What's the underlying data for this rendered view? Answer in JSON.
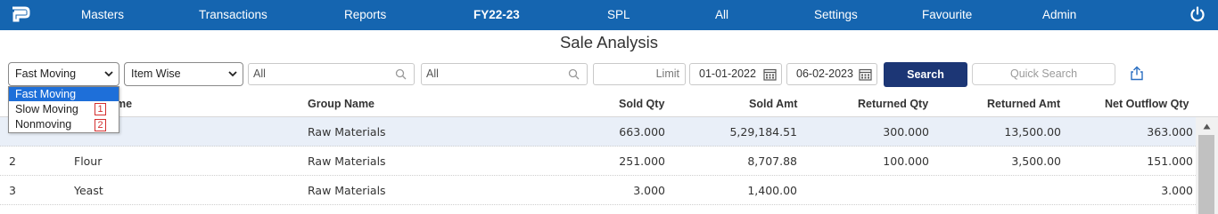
{
  "nav": {
    "items": [
      "Masters",
      "Transactions",
      "Reports",
      "FY22-23",
      "SPL",
      "All",
      "Settings",
      "Favourite",
      "Admin"
    ],
    "logo_icon": "app-logo-icon",
    "power_icon": "power-icon",
    "color": "#1565b0"
  },
  "page": {
    "title": "Sale Analysis"
  },
  "filters": {
    "movement_select": "Fast Moving",
    "grouping_select": "Item Wise",
    "search1_value": "All",
    "search2_value": "All",
    "limit_placeholder": "Limit",
    "from_date": "01-01-2022",
    "to_date": "06-02-2023",
    "search_button": "Search",
    "quick_search_placeholder": "Quick Search"
  },
  "dropdown": {
    "options": [
      "Fast Moving",
      "Slow Moving",
      "Nonmoving"
    ],
    "badges": [
      "1",
      "2"
    ]
  },
  "table": {
    "columns": [
      "Item Name",
      "Group Name",
      "Sold Qty",
      "Sold Amt",
      "Returned Qty",
      "Returned Amt",
      "Net Outflow Qty"
    ],
    "header_visible_fragment": "me",
    "rows": [
      {
        "sn": "",
        "name": "",
        "group": "Raw Materials",
        "sold_qty": "663.000",
        "sold_amt": "5,29,184.51",
        "ret_qty": "300.000",
        "ret_amt": "13,500.00",
        "net": "363.000"
      },
      {
        "sn": "2",
        "name": "Flour",
        "group": "Raw Materials",
        "sold_qty": "251.000",
        "sold_amt": "8,707.88",
        "ret_qty": "100.000",
        "ret_amt": "3,500.00",
        "net": "151.000"
      },
      {
        "sn": "3",
        "name": "Yeast",
        "group": "Raw Materials",
        "sold_qty": "3.000",
        "sold_amt": "1,400.00",
        "ret_qty": "",
        "ret_amt": "",
        "net": "3.000"
      }
    ]
  },
  "colors": {
    "search_button_bg": "#1c3675",
    "dropdown_active": "#1e6fd9",
    "badge": "#d32f2f",
    "selected_row": "#e9eff8"
  }
}
